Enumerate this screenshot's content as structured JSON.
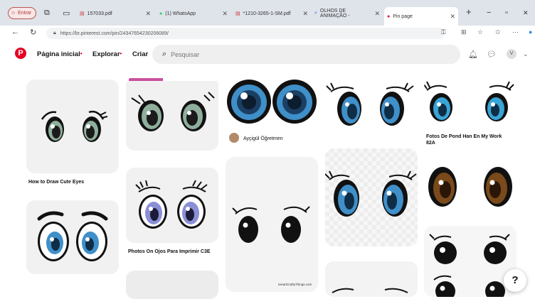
{
  "browser": {
    "profile_label": "Entrar",
    "tabs": [
      {
        "title": "157033.pdf",
        "icon": "pdf-icon"
      },
      {
        "title": "(1) WhatsApp",
        "icon": "whatsapp-icon"
      },
      {
        "title": "*1210-3265-1-SM.pdf",
        "icon": "pdf-icon"
      },
      {
        "title": "OLHOS DE ANIMAÇÃO -",
        "icon": "search-icon"
      },
      {
        "title": "Pin page",
        "icon": "pinterest-icon"
      }
    ],
    "new_tab_label": "+",
    "minimize_label": "−",
    "restore_label": "▫",
    "close_label": "✕",
    "url": "https://br.pinterest.com/pin/24347654230206089/"
  },
  "pinterest": {
    "nav": {
      "home": "Página inicial",
      "explore": "Explorar",
      "create": "Criar"
    },
    "search_placeholder": "Pesquisar",
    "avatar_letter": "V",
    "help_label": "?"
  },
  "pins": {
    "col1_top_caption": "How to Draw Cute Eyes",
    "col2_mid_caption": "Photos On Ojos Para Imprimir C3E",
    "col3_author": "Ayçigül Öğretmen",
    "col5_top_caption": "Fotos De Pond Han En My Work 82A",
    "watermark": "iHeartCraftyThings.com"
  },
  "colors": {
    "pinterest_red": "#e60023",
    "eye_green": "#8fae9c",
    "eye_blue": "#3f8fc9",
    "eye_purple": "#8a8fd6",
    "eye_brown": "#7a4a1b"
  }
}
